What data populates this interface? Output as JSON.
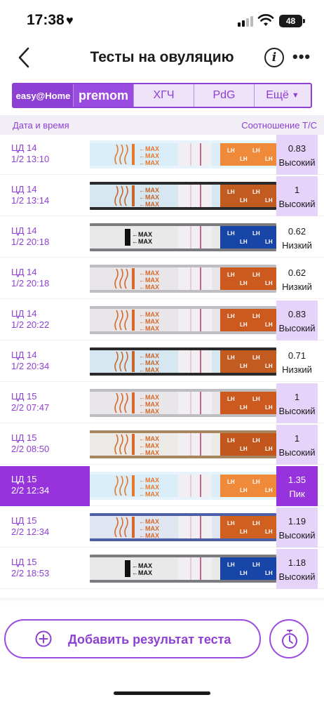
{
  "status_bar": {
    "time": "17:38",
    "heart": "♥",
    "battery": "48"
  },
  "header": {
    "title": "Тесты на овуляцию",
    "info_icon": "i",
    "more_icon": "•••"
  },
  "tabs": [
    {
      "label": "easy@Home",
      "active": true
    },
    {
      "label": "premom",
      "active": true
    },
    {
      "label": "ХГЧ",
      "active": false
    },
    {
      "label": "PdG",
      "active": false
    },
    {
      "label": "Ещё",
      "active": false
    }
  ],
  "columns": {
    "left": "Дата и время",
    "right": "Соотношение T/C"
  },
  "strip_text": {
    "max": "MAX",
    "lh": "LH"
  },
  "rows": [
    {
      "cycle": "ЦД 14",
      "datetime": "1/2 13:10",
      "ratio": "0.83",
      "level": "Высокий",
      "style": "high",
      "strip": "orange-light"
    },
    {
      "cycle": "ЦД 14",
      "datetime": "1/2 13:14",
      "ratio": "1",
      "level": "Высокий",
      "style": "high",
      "strip": "orange-dark"
    },
    {
      "cycle": "ЦД 14",
      "datetime": "1/2 20:18",
      "ratio": "0.62",
      "level": "Низкий",
      "style": "low",
      "strip": "blue"
    },
    {
      "cycle": "ЦД 14",
      "datetime": "1/2 20:18",
      "ratio": "0.62",
      "level": "Низкий",
      "style": "low",
      "strip": "orange"
    },
    {
      "cycle": "ЦД 14",
      "datetime": "1/2 20:22",
      "ratio": "0.83",
      "level": "Высокий",
      "style": "high",
      "strip": "orange"
    },
    {
      "cycle": "ЦД 14",
      "datetime": "1/2 20:34",
      "ratio": "0.71",
      "level": "Низкий",
      "style": "low",
      "strip": "orange-dark"
    },
    {
      "cycle": "ЦД 15",
      "datetime": "2/2 07:47",
      "ratio": "1",
      "level": "Высокий",
      "style": "high",
      "strip": "orange"
    },
    {
      "cycle": "ЦД 15",
      "datetime": "2/2 08:50",
      "ratio": "1",
      "level": "Высокий",
      "style": "high",
      "strip": "orange-wood"
    },
    {
      "cycle": "ЦД 15",
      "datetime": "2/2 12:34",
      "ratio": "1.35",
      "level": "Пик",
      "style": "peak",
      "strip": "orange-light",
      "selected": true
    },
    {
      "cycle": "ЦД 15",
      "datetime": "2/2 12:34",
      "ratio": "1.19",
      "level": "Высокий",
      "style": "high",
      "strip": "orange-blue-bg"
    },
    {
      "cycle": "ЦД 15",
      "datetime": "2/2 18:53",
      "ratio": "1.18",
      "level": "Высокий",
      "style": "high",
      "strip": "blue"
    }
  ],
  "bottom": {
    "add_label": "Добавить результат теста",
    "add_icon": "plus-circle-icon",
    "timer_icon": "stopwatch-icon"
  },
  "colors": {
    "accent": "#8e3fd4",
    "peak": "#9733dd",
    "high_bg": "#e5d3fa",
    "orange": "#e2782a",
    "blue": "#1a4fb0"
  }
}
